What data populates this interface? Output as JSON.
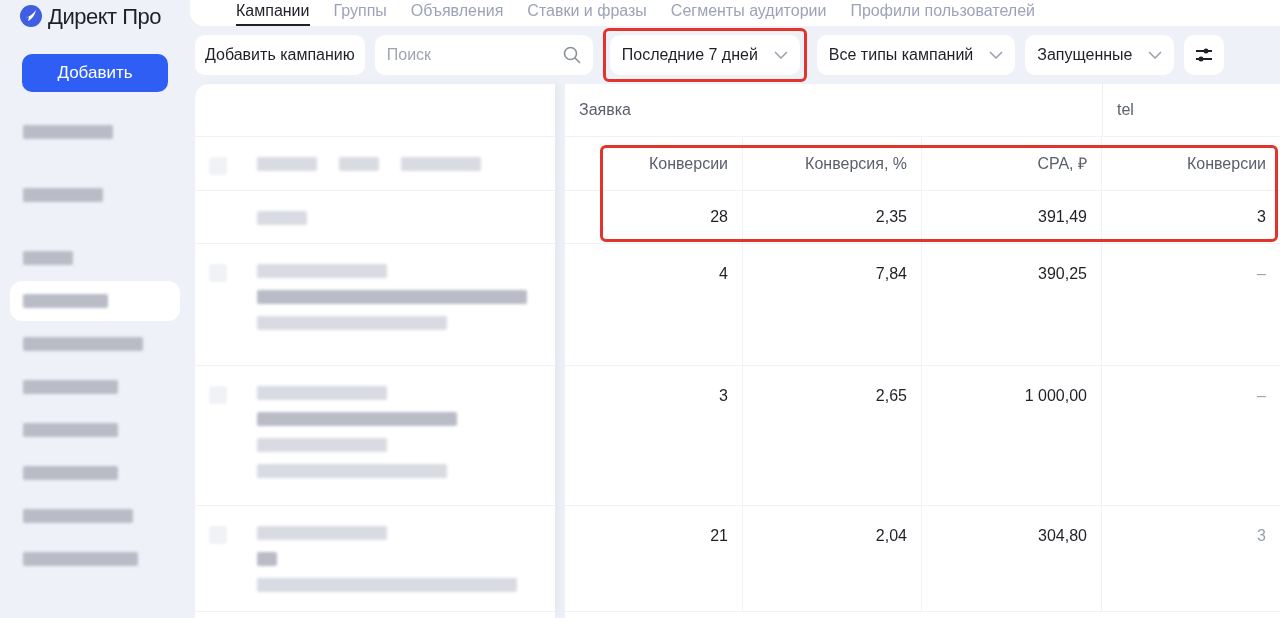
{
  "logo": {
    "text": "Директ Про"
  },
  "add_button": "Добавить",
  "sidebar": {
    "items": [
      {
        "selected": false
      },
      {
        "selected": false
      },
      {
        "selected": false
      },
      {
        "selected": true
      },
      {
        "selected": false
      },
      {
        "selected": false
      },
      {
        "selected": false
      },
      {
        "selected": false
      },
      {
        "selected": false
      },
      {
        "selected": false
      }
    ]
  },
  "tabs": [
    {
      "label": "Кампании",
      "selected": true
    },
    {
      "label": "Группы",
      "selected": false
    },
    {
      "label": "Объявления",
      "selected": false
    },
    {
      "label": "Ставки и фразы",
      "selected": false
    },
    {
      "label": "Сегменты аудитории",
      "selected": false
    },
    {
      "label": "Профили пользователей",
      "selected": false
    }
  ],
  "toolbar": {
    "add_campaign": "Добавить кампанию",
    "search": {
      "placeholder": "Поиск"
    },
    "filters": [
      {
        "label": "Последние 7 дней",
        "highlighted": true
      },
      {
        "label": "Все типы кампаний",
        "highlighted": false
      },
      {
        "label": "Запущенные",
        "highlighted": false
      }
    ]
  },
  "table": {
    "groups": [
      {
        "label": "Заявка"
      },
      {
        "label": "tel"
      }
    ],
    "columns": [
      "Конверсии",
      "Конверсия, %",
      "CPA, ₽",
      "Конверсии"
    ],
    "summary_highlighted": true,
    "total": [
      "28",
      "2,35",
      "391,49",
      "3"
    ],
    "rows": [
      [
        "4",
        "7,84",
        "390,25",
        "–"
      ],
      [
        "3",
        "2,65",
        "1 000,00",
        "–"
      ],
      [
        "21",
        "2,04",
        "304,80",
        "3"
      ]
    ]
  }
}
